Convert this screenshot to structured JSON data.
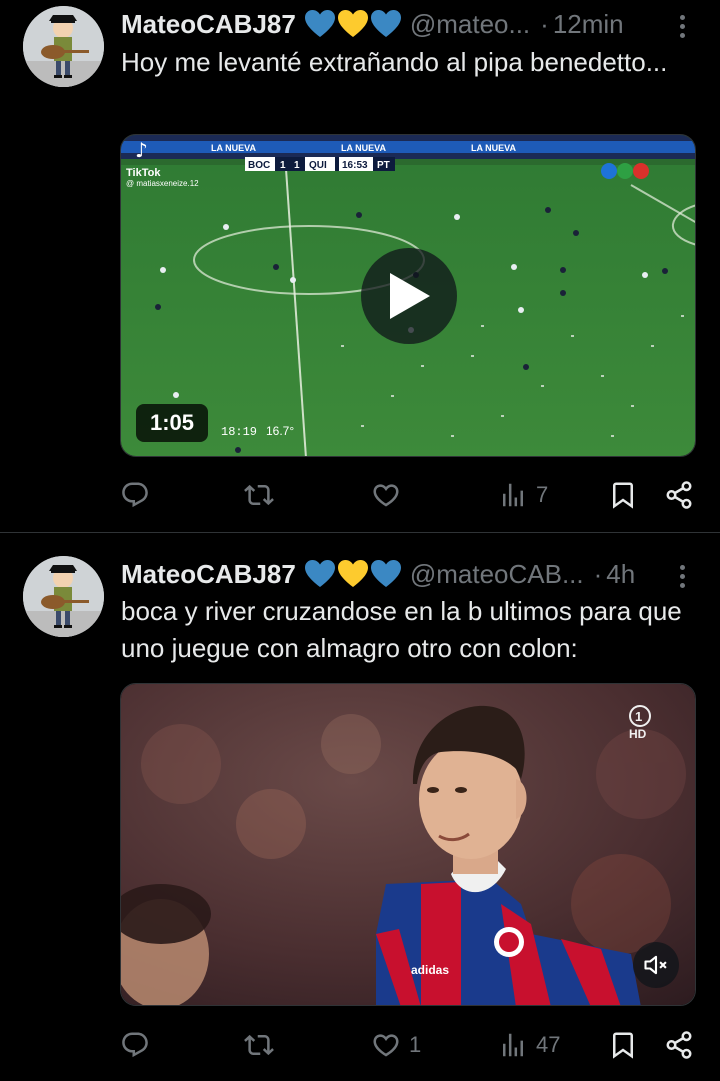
{
  "tweets": [
    {
      "display_name": "MateoCABJ87",
      "handle": "@mateo...",
      "separator": "·",
      "time": "12min",
      "text": "Hoy me levanté extrañando al pipa benedetto...",
      "media": {
        "type": "video",
        "duration": "1:05",
        "tiktok_label": "TikTok",
        "tiktok_user": "@ matiasxeneize.12",
        "score_team1": "BOC",
        "score_g1": "1",
        "score_g2": "1",
        "score_team2": "QUI",
        "score_clock": "16:53",
        "score_period": "PT",
        "overlay_time": "18:19",
        "overlay_temp": "16.7°",
        "ad_board": "LA NUEVA"
      },
      "stats": {
        "replies": "",
        "retweets": "",
        "likes": "",
        "views": "7"
      }
    },
    {
      "display_name": "MateoCABJ87",
      "handle": "@mateoCAB...",
      "separator": "·",
      "time": "4h",
      "text": "boca y river cruzandose en la b ultimos para que uno juegue con almagro otro con colon:",
      "media": {
        "type": "video",
        "channel_logo": "1",
        "channel_hd": "HD",
        "kit_brand": "adidas"
      },
      "stats": {
        "replies": "",
        "retweets": "",
        "likes": "1",
        "views": "47"
      }
    }
  ],
  "colors": {
    "background": "#000000",
    "text": "#e7e9ea",
    "muted": "#71767b",
    "divider": "#2f3336",
    "heart_blue": "#1d9bf0",
    "heart_yellow": "#ffcc00"
  },
  "icons": {
    "more": "more-dots-icon",
    "reply": "reply-icon",
    "retweet": "retweet-icon",
    "like": "like-icon",
    "views": "views-icon",
    "bookmark": "bookmark-icon",
    "share": "share-icon",
    "play": "play-icon",
    "mute": "mute-icon"
  }
}
